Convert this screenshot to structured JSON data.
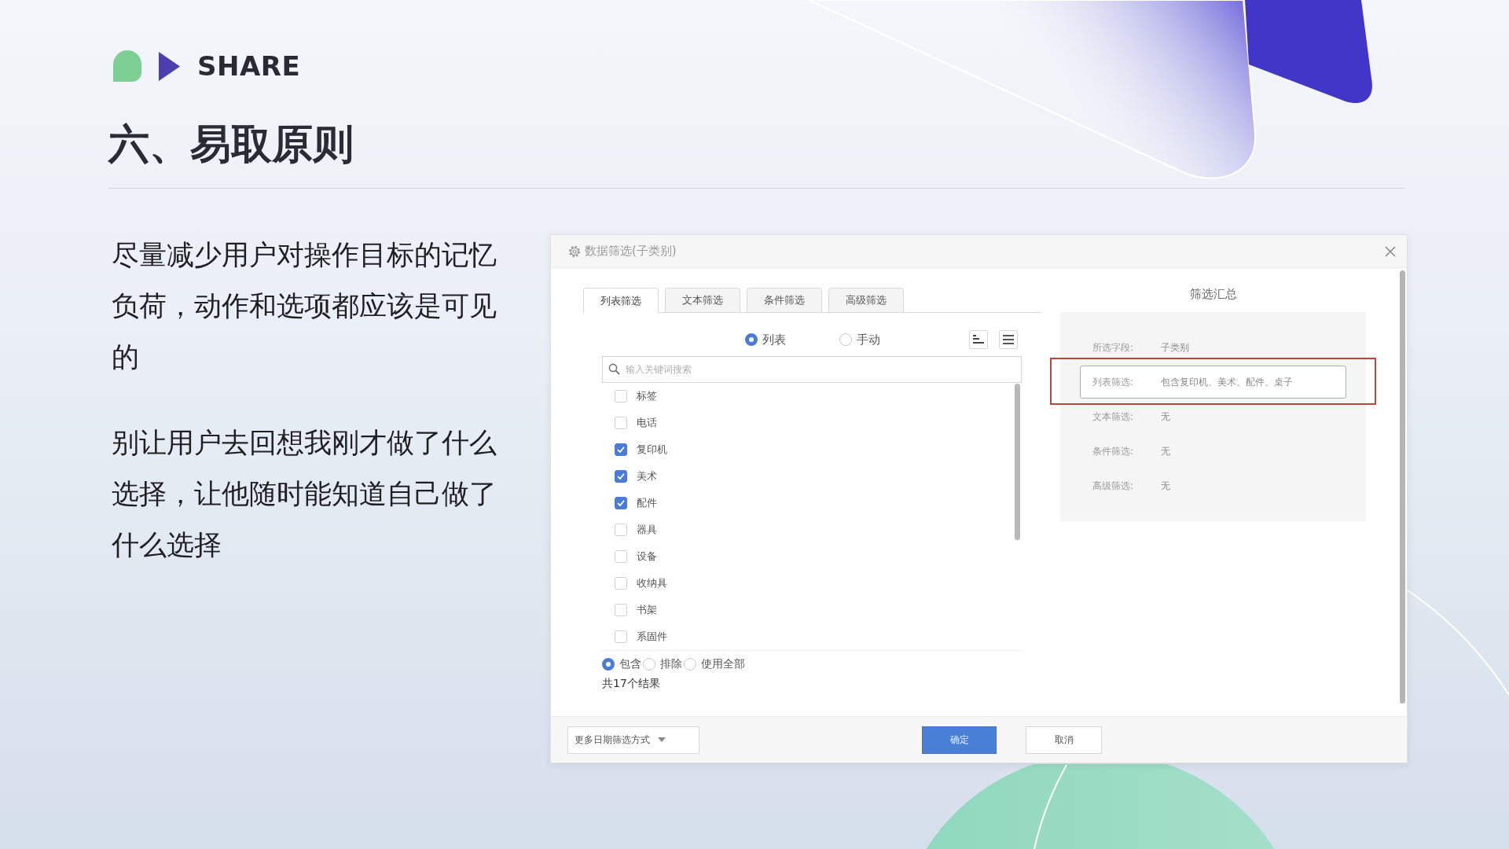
{
  "header": {
    "brand": "SHARE",
    "title": "六、易取原则"
  },
  "paragraphs": [
    "尽量减少用户对操作目标的记忆负荷，动作和选项都应该是可见的",
    "别让用户去回想我刚才做了什么选择，让他随时能知道自己做了什么选择"
  ],
  "dialog": {
    "title": "数据筛选(子类别)",
    "tabs": [
      {
        "label": "列表筛选",
        "selected": true
      },
      {
        "label": "文本筛选",
        "selected": false
      },
      {
        "label": "条件筛选",
        "selected": false
      },
      {
        "label": "高级筛选",
        "selected": false
      }
    ],
    "modes": [
      {
        "label": "列表",
        "selected": true
      },
      {
        "label": "手动",
        "selected": false
      }
    ],
    "search": {
      "placeholder": "输入关键词搜索"
    },
    "items": [
      {
        "label": "标签",
        "checked": false
      },
      {
        "label": "电话",
        "checked": false
      },
      {
        "label": "复印机",
        "checked": true
      },
      {
        "label": "美术",
        "checked": true
      },
      {
        "label": "配件",
        "checked": true
      },
      {
        "label": "器具",
        "checked": false
      },
      {
        "label": "设备",
        "checked": false
      },
      {
        "label": "收纳具",
        "checked": false
      },
      {
        "label": "书架",
        "checked": false
      },
      {
        "label": "系固件",
        "checked": false
      }
    ],
    "match_options": [
      {
        "label": "包含",
        "selected": true
      },
      {
        "label": "排除",
        "selected": false
      },
      {
        "label": "使用全部",
        "selected": false
      }
    ],
    "result_count": "共17个结果",
    "summary": {
      "title": "筛选汇总",
      "rows": [
        {
          "label": "所选字段:",
          "value": "子类别",
          "highlighted": false
        },
        {
          "label": "列表筛选:",
          "value": "包含复印机、美术、配件、桌子",
          "highlighted": true
        },
        {
          "label": "文本筛选:",
          "value": "无",
          "highlighted": false
        },
        {
          "label": "条件筛选:",
          "value": "无",
          "highlighted": false
        },
        {
          "label": "高级筛选:",
          "value": "无",
          "highlighted": false
        }
      ]
    },
    "date_dropdown": "更多日期筛选方式",
    "buttons": [
      {
        "label": "确定",
        "kind": "primary"
      },
      {
        "label": "取消",
        "kind": "secondary"
      }
    ]
  }
}
